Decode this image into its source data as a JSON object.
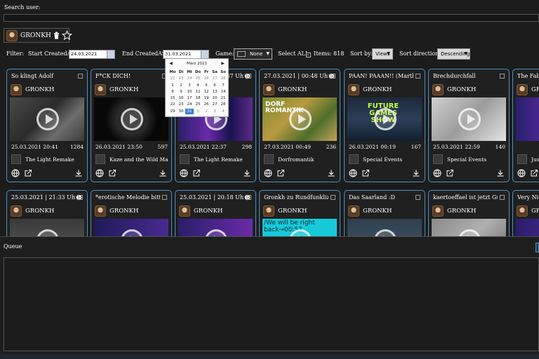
{
  "search": {
    "label": "Search user:",
    "value": ""
  },
  "user_chip": {
    "name": "GRONKH"
  },
  "filters": {
    "label": "Filter:",
    "start_label": "Start CreatedAt:",
    "start_value": "24.03.2021",
    "end_label": "End CreatedAt:",
    "end_value": "31.03.2021",
    "game_label": "Game:",
    "game_value": "None",
    "select_all_label": "Select ALL",
    "items_label": "Items: 818",
    "sort_by_label": "Sort by:",
    "sort_by_value": "Views",
    "sort_dir_label": "Sort direction:",
    "sort_dir_value": "Descending"
  },
  "datepicker": {
    "month": "März 2021",
    "weekdays": [
      "Mo",
      "Di",
      "Mi",
      "Do",
      "Fr",
      "Sa",
      "So"
    ],
    "weeks": [
      [
        "22",
        "23",
        "24",
        "25",
        "26",
        "27",
        "28"
      ],
      [
        "1",
        "2",
        "3",
        "4",
        "5",
        "6",
        "7"
      ],
      [
        "8",
        "9",
        "10",
        "11",
        "12",
        "13",
        "14"
      ],
      [
        "15",
        "16",
        "17",
        "18",
        "19",
        "20",
        "21"
      ],
      [
        "22",
        "23",
        "24",
        "25",
        "26",
        "27",
        "28"
      ],
      [
        "29",
        "30",
        "31",
        "1",
        "2",
        "3",
        "4"
      ]
    ],
    "selected": "31"
  },
  "cards": [
    {
      "title": "So klingt Adolf",
      "owner": "GRONKH",
      "date": "25.03.2021 20:41",
      "views": "1284",
      "game": "The Light Remake"
    },
    {
      "title": "F*CK DICH!",
      "owner": "GRONKH",
      "date": "26.03.2021 23:50",
      "views": "597",
      "game": "Kaze and the Wild Ma"
    },
    {
      "title": "25.03.2021 | 22:37 Uhr",
      "owner": "GRONKH",
      "date": "25.03.2021 22:37",
      "views": "298",
      "game": "The Light Remake"
    },
    {
      "title": "27.03.2021 | 00:48 Uhr",
      "owner": "GRONKH",
      "date": "27.03.2021 00:49",
      "views": "236",
      "game": "Dorfromantik"
    },
    {
      "title": "PAAN! PAAAN!! (Martha i",
      "owner": "GRONKH",
      "date": "26.03.2021 00:19",
      "views": "167",
      "game": "Special Events"
    },
    {
      "title": "Brechdurchfall",
      "owner": "GRONKH",
      "date": "25.03.2021 22:59",
      "views": "140",
      "game": "Special Events"
    },
    {
      "title": "The Fable",
      "owner": "GRONKH",
      "date": "",
      "views": "",
      "game": "Jus"
    },
    {
      "title": "25.03.2021 | 21:33 Uhr",
      "owner": "GRONKH",
      "date": "",
      "views": "",
      "game": ""
    },
    {
      "title": "*erotische Melodie bitte ein",
      "owner": "GRONKH",
      "date": "",
      "views": "",
      "game": ""
    },
    {
      "title": "25.03.2021 | 20:18 Uhr",
      "owner": "GRONKH",
      "date": "",
      "views": "",
      "game": ""
    },
    {
      "title": "Gronkh zu Rundfunklizenz",
      "owner": "GRONKH",
      "date": "",
      "views": "",
      "game": ""
    },
    {
      "title": "Das Saarland :D",
      "owner": "GRONKH",
      "date": "",
      "views": "",
      "game": ""
    },
    {
      "title": "kaertoeffael ist jetzt Grafike",
      "owner": "GRONKH",
      "date": "",
      "views": "",
      "game": ""
    },
    {
      "title": "Very Nice",
      "owner": "GRONKH",
      "date": "",
      "views": "",
      "game": ""
    }
  ],
  "thumb_text": {
    "dorf": "DORF ROMANTIK",
    "future": "FUTURE GAMES SHOW",
    "back": "/We will be right back→00:57"
  },
  "queue": {
    "label": "Queue"
  }
}
